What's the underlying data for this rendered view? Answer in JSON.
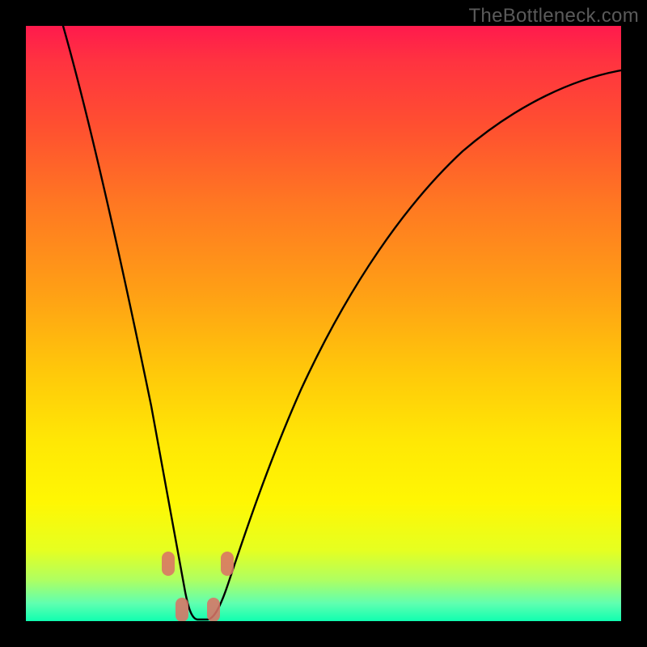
{
  "watermark": "TheBottleneck.com",
  "chart_data": {
    "type": "line",
    "title": "",
    "xlabel": "",
    "ylabel": "",
    "xlim": [
      0,
      1
    ],
    "ylim": [
      0,
      1
    ],
    "series": [
      {
        "name": "curve",
        "x": [
          0.0,
          0.07,
          0.12,
          0.16,
          0.19,
          0.22,
          0.24,
          0.26,
          0.27,
          0.28,
          0.3,
          0.35,
          0.4,
          0.45,
          0.5,
          0.55,
          0.6,
          0.65,
          0.7,
          0.75,
          0.8,
          0.85,
          0.9,
          0.95,
          1.0
        ],
        "y": [
          1.0,
          0.8,
          0.6,
          0.4,
          0.25,
          0.15,
          0.08,
          0.04,
          0.02,
          0.0,
          0.0,
          0.05,
          0.15,
          0.25,
          0.35,
          0.43,
          0.51,
          0.58,
          0.64,
          0.7,
          0.75,
          0.79,
          0.83,
          0.87,
          0.9
        ]
      }
    ],
    "annotations": [
      {
        "name": "marker-left-upper",
        "x": 0.236,
        "y": 0.098
      },
      {
        "name": "marker-left-lower",
        "x": 0.26,
        "y": 0.021
      },
      {
        "name": "marker-right-lower",
        "x": 0.313,
        "y": 0.021
      },
      {
        "name": "marker-right-upper",
        "x": 0.337,
        "y": 0.098
      }
    ]
  }
}
